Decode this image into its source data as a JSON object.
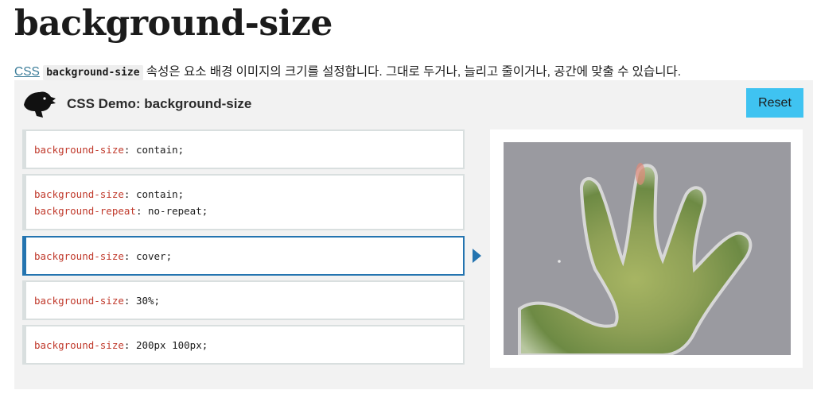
{
  "page": {
    "title": "background-size",
    "intro": {
      "link_text": "CSS",
      "code_text": "background-size",
      "rest_text": " 속성은 요소 배경 이미지의 크기를 설정합니다. 그대로 두거나, 늘리고 줄이거나, 공간에 맞출 수 있습니다."
    }
  },
  "demo": {
    "title": "CSS Demo: background-size",
    "logo_icon": "dinosaur-head-icon",
    "reset_label": "Reset",
    "selected_index": 2,
    "colors": {
      "accent": "#2474b0",
      "reset_bg": "#3fc3f1",
      "property": "#c0392b",
      "panel_bg": "#f2f2f2"
    },
    "choices": [
      {
        "lines": [
          {
            "prop": "background-size",
            "value": ": contain;"
          }
        ]
      },
      {
        "lines": [
          {
            "prop": "background-size",
            "value": ": contain;"
          },
          {
            "prop": "background-repeat",
            "value": ": no-repeat;"
          }
        ]
      },
      {
        "lines": [
          {
            "prop": "background-size",
            "value": ": cover;"
          }
        ]
      },
      {
        "lines": [
          {
            "prop": "background-size",
            "value": ": 30%;"
          }
        ]
      },
      {
        "lines": [
          {
            "prop": "background-size",
            "value": ": 200px 100px;"
          }
        ]
      }
    ],
    "output_image": "hand-cutout-image"
  }
}
